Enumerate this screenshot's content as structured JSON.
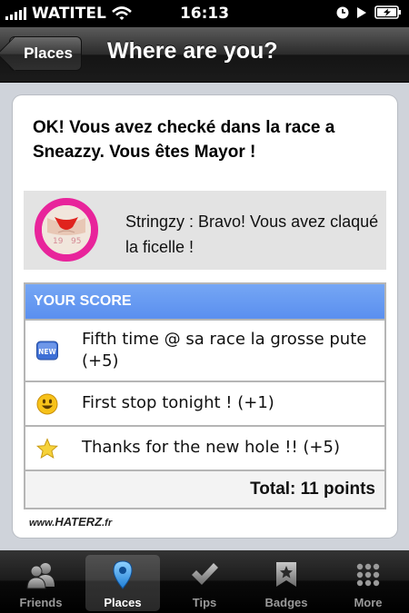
{
  "status_bar": {
    "carrier": "WATITEL",
    "time": "16:13"
  },
  "nav": {
    "back_label": "Places",
    "title": "Where are you?"
  },
  "checkin": {
    "headline": "OK! Vous avez checké dans la race a Sneazzy. Vous êtes Mayor !",
    "message": "Stringzy : Bravo! Vous avez claqué la ficelle !"
  },
  "score": {
    "header": "YOUR SCORE",
    "items": [
      {
        "icon": "new-badge-icon",
        "text": "Fifth time @ sa race la grosse pute (+5)"
      },
      {
        "icon": "smiley-icon",
        "text": "First stop tonight ! (+1)"
      },
      {
        "icon": "star-icon",
        "text": "Thanks for the new hole !! (+5)"
      }
    ],
    "total": "Total: 11 points"
  },
  "watermark": {
    "prefix": "www.",
    "brand": "HATERZ",
    "suffix": ".fr"
  },
  "tabs": [
    {
      "label": "Friends",
      "icon": "friends-icon",
      "active": false
    },
    {
      "label": "Places",
      "icon": "map-pin-icon",
      "active": true
    },
    {
      "label": "Tips",
      "icon": "checkmark-icon",
      "active": false
    },
    {
      "label": "Badges",
      "icon": "badge-star-icon",
      "active": false
    },
    {
      "label": "More",
      "icon": "more-grid-icon",
      "active": false
    }
  ],
  "colors": {
    "score_header": "#5a8fef",
    "avatar_ring": "#e8249b"
  }
}
